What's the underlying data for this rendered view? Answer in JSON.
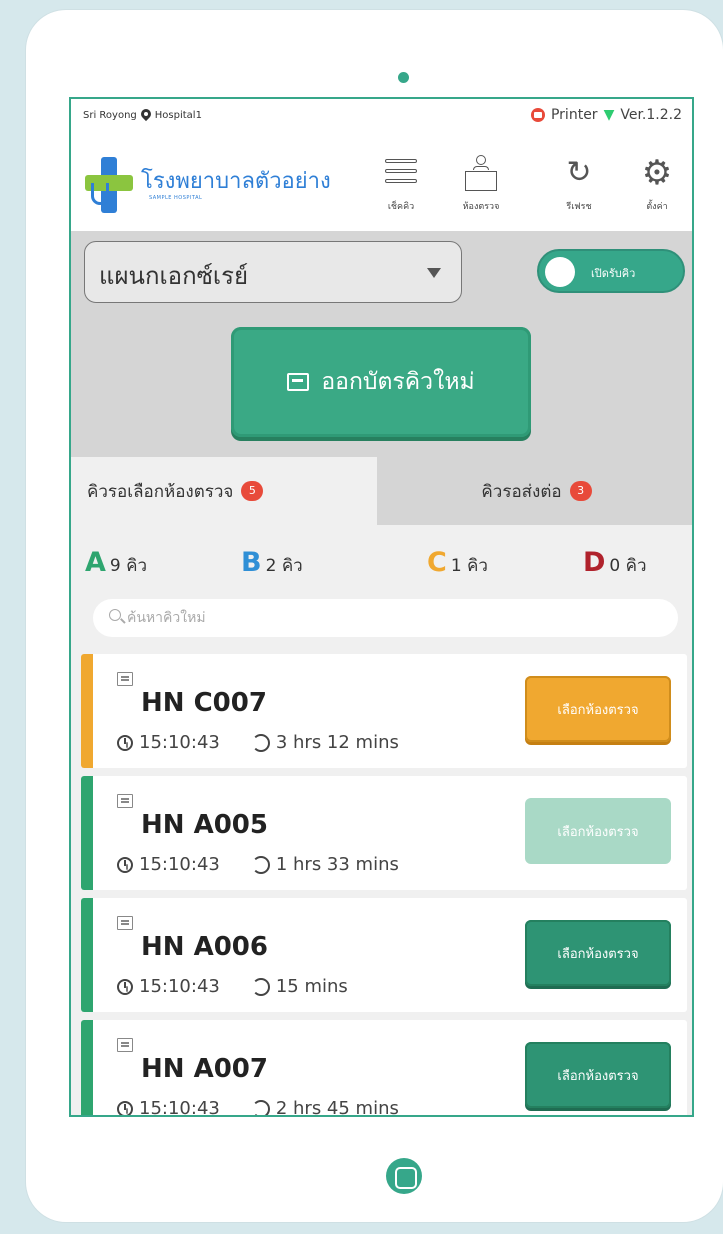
{
  "status_bar": {
    "location": "Sri Royong",
    "hospital": "Hospital1",
    "printer_label": "Printer",
    "version": "Ver.1.2.2"
  },
  "header": {
    "hospital_name": "โรงพยาบาลตัวอย่าง",
    "hospital_sub": "SAMPLE HOSPITAL",
    "buttons": [
      {
        "label": "เช็คคิว",
        "icon": "menu-icon"
      },
      {
        "label": "ห้องตรวจ",
        "icon": "exam-room-icon"
      },
      {
        "label": "รีเฟรช",
        "icon": "refresh-icon"
      },
      {
        "label": "ตั้งค่า",
        "icon": "gear-icon"
      }
    ]
  },
  "controls": {
    "department": "แผนกเอกซ์เรย์",
    "toggle_label": "เปิดรับคิว",
    "toggle_on": true,
    "new_ticket_label": "ออกบัตรคิวใหม่"
  },
  "tabs": [
    {
      "label": "คิวรอเลือกห้องตรวจ",
      "badge": "5",
      "active": true
    },
    {
      "label": "คิวรอส่งต่อ",
      "badge": "3",
      "active": false
    }
  ],
  "counts": [
    {
      "letter": "A",
      "value": "9 คิว",
      "color": "#2ea56f"
    },
    {
      "letter": "B",
      "value": "2 คิว",
      "color": "#2f8fd6"
    },
    {
      "letter": "C",
      "value": "1 คิว",
      "color": "#f0a830"
    },
    {
      "letter": "D",
      "value": "0 คิว",
      "color": "#b0222c"
    }
  ],
  "search": {
    "placeholder": "ค้นหาคิวใหม่"
  },
  "queue": [
    {
      "hn": "HN C007",
      "time": "15:10:43",
      "wait": "3 hrs 12 mins",
      "button": "เลือกห้องตรวจ",
      "state": "orange",
      "bar_color": "#f0a830"
    },
    {
      "hn": "HN A005",
      "time": "15:10:43",
      "wait": "1 hrs 33 mins",
      "button": "เลือกห้องตรวจ",
      "state": "disabled",
      "bar_color": "#2ea56f"
    },
    {
      "hn": "HN A006",
      "time": "15:10:43",
      "wait": "15 mins",
      "button": "เลือกห้องตรวจ",
      "state": "green",
      "bar_color": "#2ea56f"
    },
    {
      "hn": "HN A007",
      "time": "15:10:43",
      "wait": "2 hrs 45 mins",
      "button": "เลือกห้องตรวจ",
      "state": "green",
      "bar_color": "#2ea56f"
    }
  ]
}
